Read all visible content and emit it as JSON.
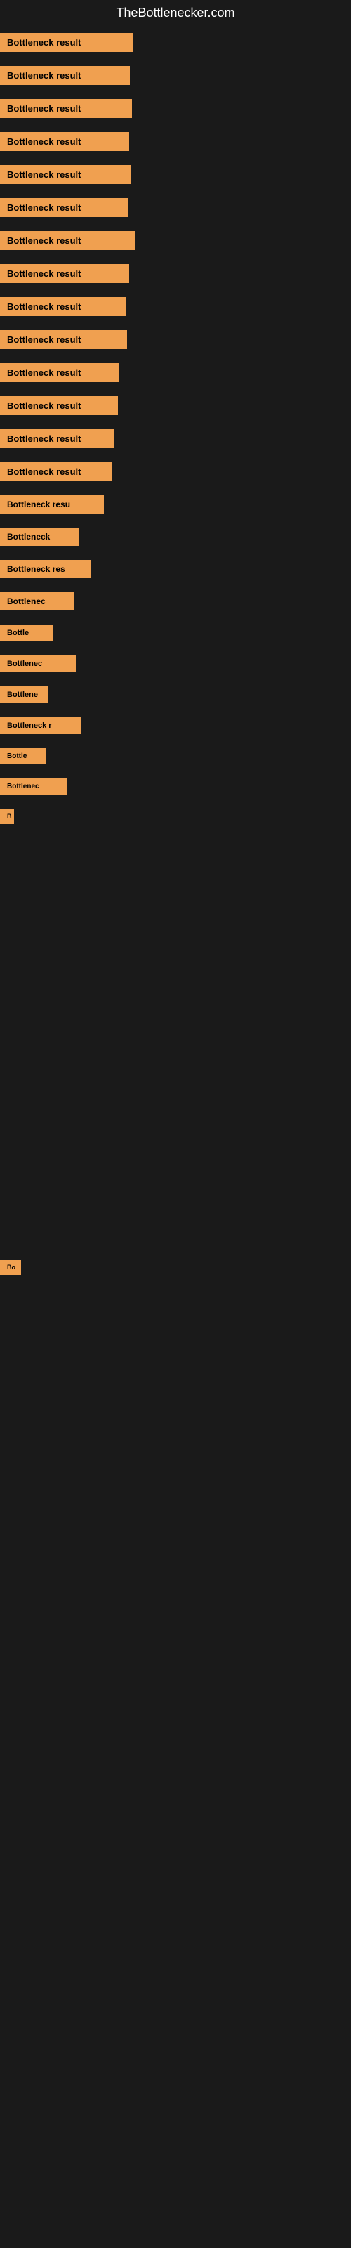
{
  "site": {
    "title": "TheBottlenecker.com"
  },
  "rows": [
    {
      "id": 1,
      "label": "Bottleneck result",
      "width": 190
    },
    {
      "id": 2,
      "label": "Bottleneck result",
      "width": 185
    },
    {
      "id": 3,
      "label": "Bottleneck result",
      "width": 188
    },
    {
      "id": 4,
      "label": "Bottleneck result",
      "width": 184
    },
    {
      "id": 5,
      "label": "Bottleneck result",
      "width": 186
    },
    {
      "id": 6,
      "label": "Bottleneck result",
      "width": 183
    },
    {
      "id": 7,
      "label": "Bottleneck result",
      "width": 192
    },
    {
      "id": 8,
      "label": "Bottleneck result",
      "width": 184
    },
    {
      "id": 9,
      "label": "Bottleneck result",
      "width": 179
    },
    {
      "id": 10,
      "label": "Bottleneck result",
      "width": 181
    },
    {
      "id": 11,
      "label": "Bottleneck result",
      "width": 169
    },
    {
      "id": 12,
      "label": "Bottleneck result",
      "width": 168
    },
    {
      "id": 13,
      "label": "Bottleneck result",
      "width": 162
    },
    {
      "id": 14,
      "label": "Bottleneck result",
      "width": 160
    },
    {
      "id": 15,
      "label": "Bottleneck resu",
      "width": 148
    },
    {
      "id": 16,
      "label": "Bottleneck",
      "width": 112
    },
    {
      "id": 17,
      "label": "Bottleneck res",
      "width": 130
    },
    {
      "id": 18,
      "label": "Bottlenec",
      "width": 105
    },
    {
      "id": 19,
      "label": "Bottle",
      "width": 75
    },
    {
      "id": 20,
      "label": "Bottlenec",
      "width": 108
    },
    {
      "id": 21,
      "label": "Bottlene",
      "width": 68
    },
    {
      "id": 22,
      "label": "Bottleneck r",
      "width": 115
    },
    {
      "id": 23,
      "label": "Bottle",
      "width": 65
    },
    {
      "id": 24,
      "label": "Bottlenec",
      "width": 95
    },
    {
      "id": 25,
      "label": "B",
      "width": 14
    }
  ],
  "bottom_row": {
    "label": "Bo",
    "width": 30
  },
  "colors": {
    "badge_bg": "#f0a050",
    "badge_text": "#000000",
    "page_bg": "#1a1a1a",
    "title_text": "#ffffff"
  }
}
